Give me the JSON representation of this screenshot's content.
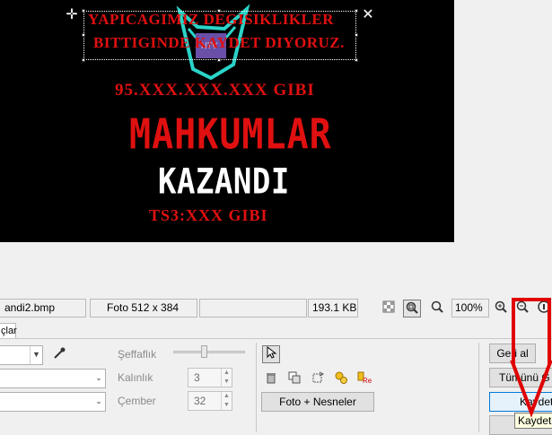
{
  "canvas": {
    "text_lines": [
      "YAPICAGIMIZ DEGISIKLIKLER",
      "BITTIGINDE KAYDET DIYORUZ.",
      "95.XXX.XXX.XXX GIBI",
      "MAHKUMLAR",
      "KAZANDI",
      "TS3:XXX GIBI"
    ],
    "image_background": "#000000",
    "text_red": "#e01010",
    "text_white": "#ffffff"
  },
  "statusbar": {
    "filename": "andi2.bmp",
    "image_info": "Foto 512 x 384",
    "filesize": "193.1 KB",
    "zoom": "100%"
  },
  "tabs": {
    "active_fragment": "çlar"
  },
  "panel": {
    "transparency_label": "Şeffaflık",
    "thickness_label": "Kalınlık",
    "thickness_value": "3",
    "circle_label": "Çember",
    "circle_value": "32",
    "photo_objects_button": "Foto + Nesneler",
    "undo_button": "Geri al",
    "undo_all_button": "Tümünü G",
    "save_button": "Kaydet",
    "save_tooltip": "Kaydet",
    "annotation_color": "#e00000"
  }
}
